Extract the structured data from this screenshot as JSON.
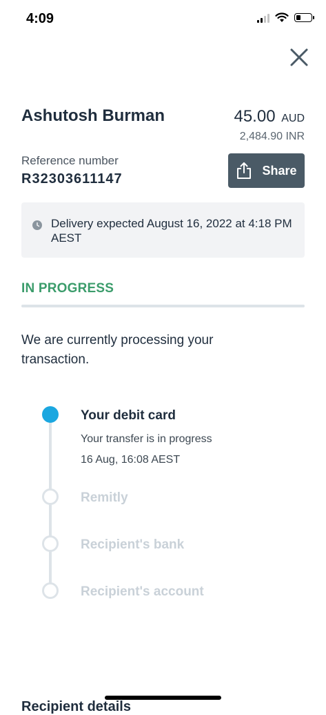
{
  "status_bar": {
    "time": "4:09"
  },
  "transfer": {
    "recipient_name": "Ashutosh Burman",
    "amount": "45.00",
    "currency": "AUD",
    "converted_amount": "2,484.90 INR",
    "reference_label": "Reference number",
    "reference_number": "R32303611147",
    "share_label": "Share"
  },
  "delivery": {
    "text": "Delivery expected August 16, 2022 at 4:18 PM AEST"
  },
  "status": {
    "label": "IN PROGRESS",
    "color": "#3b9c6b",
    "message": "We are currently processing your transaction."
  },
  "timeline": {
    "active_color": "#1ba7e0",
    "steps": [
      {
        "title": "Your debit card",
        "state": "active",
        "detail": "Your transfer is in progress",
        "timestamp": "16 Aug, 16:08 AEST"
      },
      {
        "title": "Remitly",
        "state": "pending"
      },
      {
        "title": "Recipient's bank",
        "state": "pending"
      },
      {
        "title": "Recipient's account",
        "state": "pending"
      }
    ]
  },
  "next_section": {
    "title": "Recipient details"
  },
  "icons": {
    "close": "close-icon",
    "share": "share-icon",
    "clock": "clock-icon",
    "wifi": "wifi-icon",
    "signal": "signal-icon",
    "battery": "battery-icon"
  }
}
